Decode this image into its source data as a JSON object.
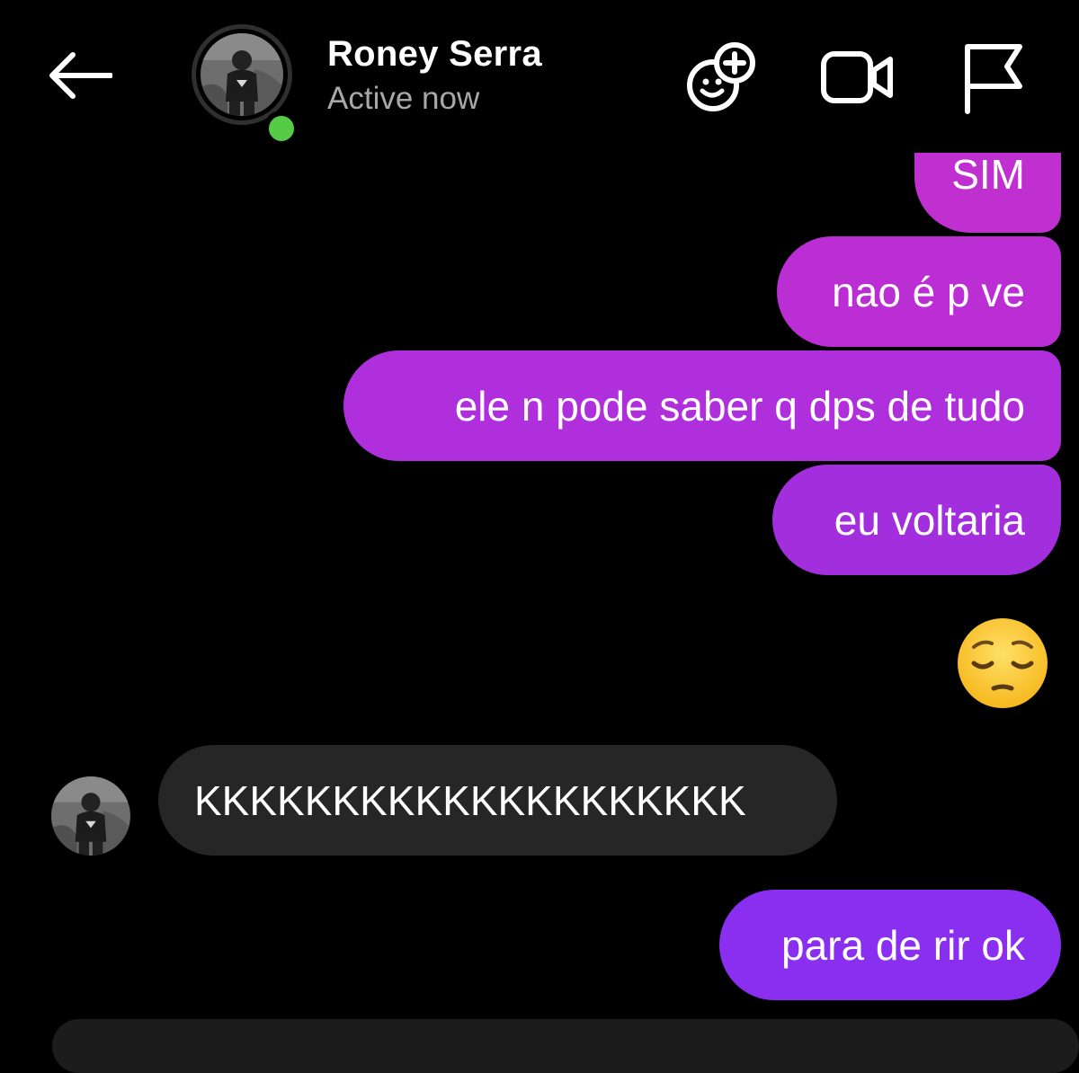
{
  "header": {
    "contact_name": "Roney Serra",
    "status": "Active now",
    "online": true,
    "icons": {
      "back": "back-arrow-icon",
      "effects": "effects-icon",
      "video": "video-call-icon",
      "report": "flag-icon"
    }
  },
  "messages": [
    {
      "direction": "outgoing",
      "text": "SIM"
    },
    {
      "direction": "outgoing",
      "text": "nao é p ve"
    },
    {
      "direction": "outgoing",
      "text": "ele n pode saber q dps de tudo"
    },
    {
      "direction": "outgoing",
      "text": "eu voltaria"
    },
    {
      "direction": "outgoing",
      "emoji": "pensive-face"
    },
    {
      "direction": "incoming",
      "text": "KKKKKKKKKKKKKKKKKKKK"
    },
    {
      "direction": "outgoing",
      "text": "para de rir ok"
    }
  ],
  "colors": {
    "background": "#000000",
    "incoming_bubble": "#262626",
    "outgoing_gradient_top": "#c02fcf",
    "outgoing_gradient_bottom": "#8a2ff0",
    "online_dot": "#56cc46",
    "status_text": "#a8a8a8"
  }
}
